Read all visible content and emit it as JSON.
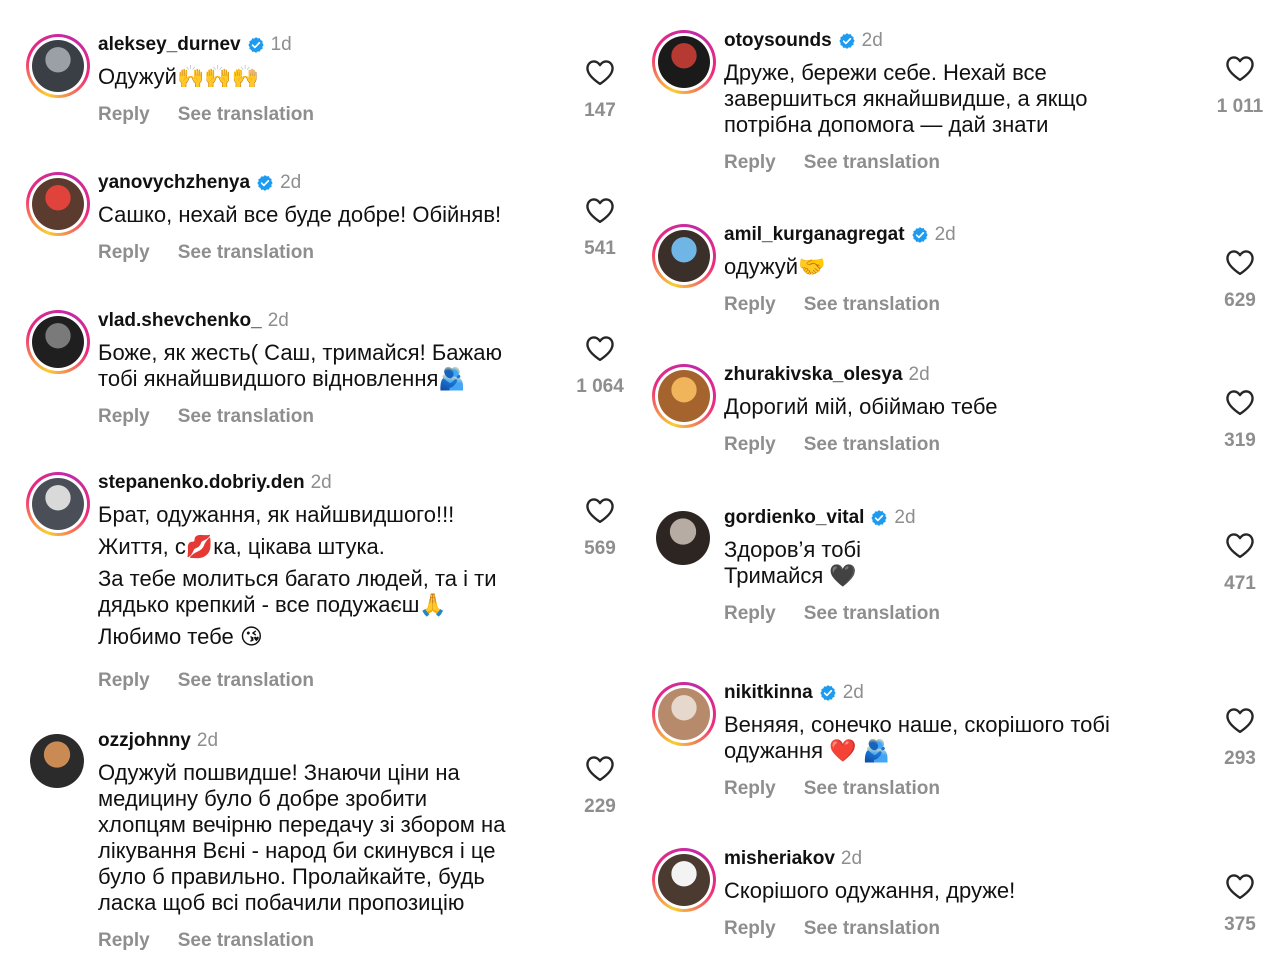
{
  "labels": {
    "reply": "Reply",
    "see_translation": "See translation"
  },
  "left": [
    {
      "username": "aleksey_durnev",
      "verified": true,
      "time": "1d",
      "lines": [
        "Одужуй🙌🙌🙌"
      ],
      "likes": "147"
    },
    {
      "username": "yanovychzhenya",
      "verified": true,
      "time": "2d",
      "lines": [
        "Сашко, нехай все буде добре! Обійняв!"
      ],
      "likes": "541"
    },
    {
      "username": "vlad.shevchenko_",
      "verified": false,
      "time": "2d",
      "lines": [
        "Боже, як жесть( Саш, тримайся! Бажаю",
        "тобі якнайшвидшого відновлення🫂"
      ],
      "likes": "1 064"
    },
    {
      "username": "stepanenko.dobriy.den",
      "verified": false,
      "time": "2d",
      "lines": [
        "Брат, одужання, як найшвидшого!!!",
        "Життя, с💋ка, цікава штука.",
        "За тебе молиться багато людей, та і ти",
        "дядько крепкий - все подужаєш🙏",
        "Любимо тебе 😘"
      ],
      "likes": "569"
    },
    {
      "username": "ozzjohnny",
      "verified": false,
      "time": "2d",
      "lines": [
        "Одужуй пошвидше! Знаючи ціни на",
        "медицину було б добре зробити",
        "хлопцям вечірню передачу зі збором на",
        "лікування Вєні - народ би скинувся і це",
        "було б правильно. Пролайкайте, будь",
        "ласка щоб всі побачили пропозицію"
      ],
      "likes": "229"
    }
  ],
  "right": [
    {
      "username": "otoysounds",
      "verified": true,
      "time": "2d",
      "lines": [
        "Друже, бережи себе. Нехай все",
        "завершиться якнайшвидше, а якщо",
        "потрібна допомога — дай знати"
      ],
      "likes": "1 011"
    },
    {
      "username": "amil_kurganagregat",
      "verified": true,
      "time": "2d",
      "lines": [
        "одужуй🤝"
      ],
      "likes": "629"
    },
    {
      "username": "zhurakivska_olesya",
      "verified": false,
      "time": "2d",
      "lines": [
        "Дорогий мій, обіймаю тебе"
      ],
      "likes": "319"
    },
    {
      "username": "gordienko_vital",
      "verified": true,
      "time": "2d",
      "lines": [
        "Здоров’я тобі",
        "Тримайся 🖤"
      ],
      "likes": "471"
    },
    {
      "username": "nikitkinna",
      "verified": true,
      "time": "2d",
      "lines": [
        "Веняяя, сонечко наше, скорішого тобі",
        "одужання ❤️ 🫂"
      ],
      "likes": "293"
    },
    {
      "username": "misheriakov",
      "verified": false,
      "time": "2d",
      "lines": [
        "Скорішого одужання, друже!"
      ],
      "likes": "375"
    }
  ],
  "colors": {
    "verified": "#1d9bf0",
    "muted": "#8e8e8e"
  }
}
